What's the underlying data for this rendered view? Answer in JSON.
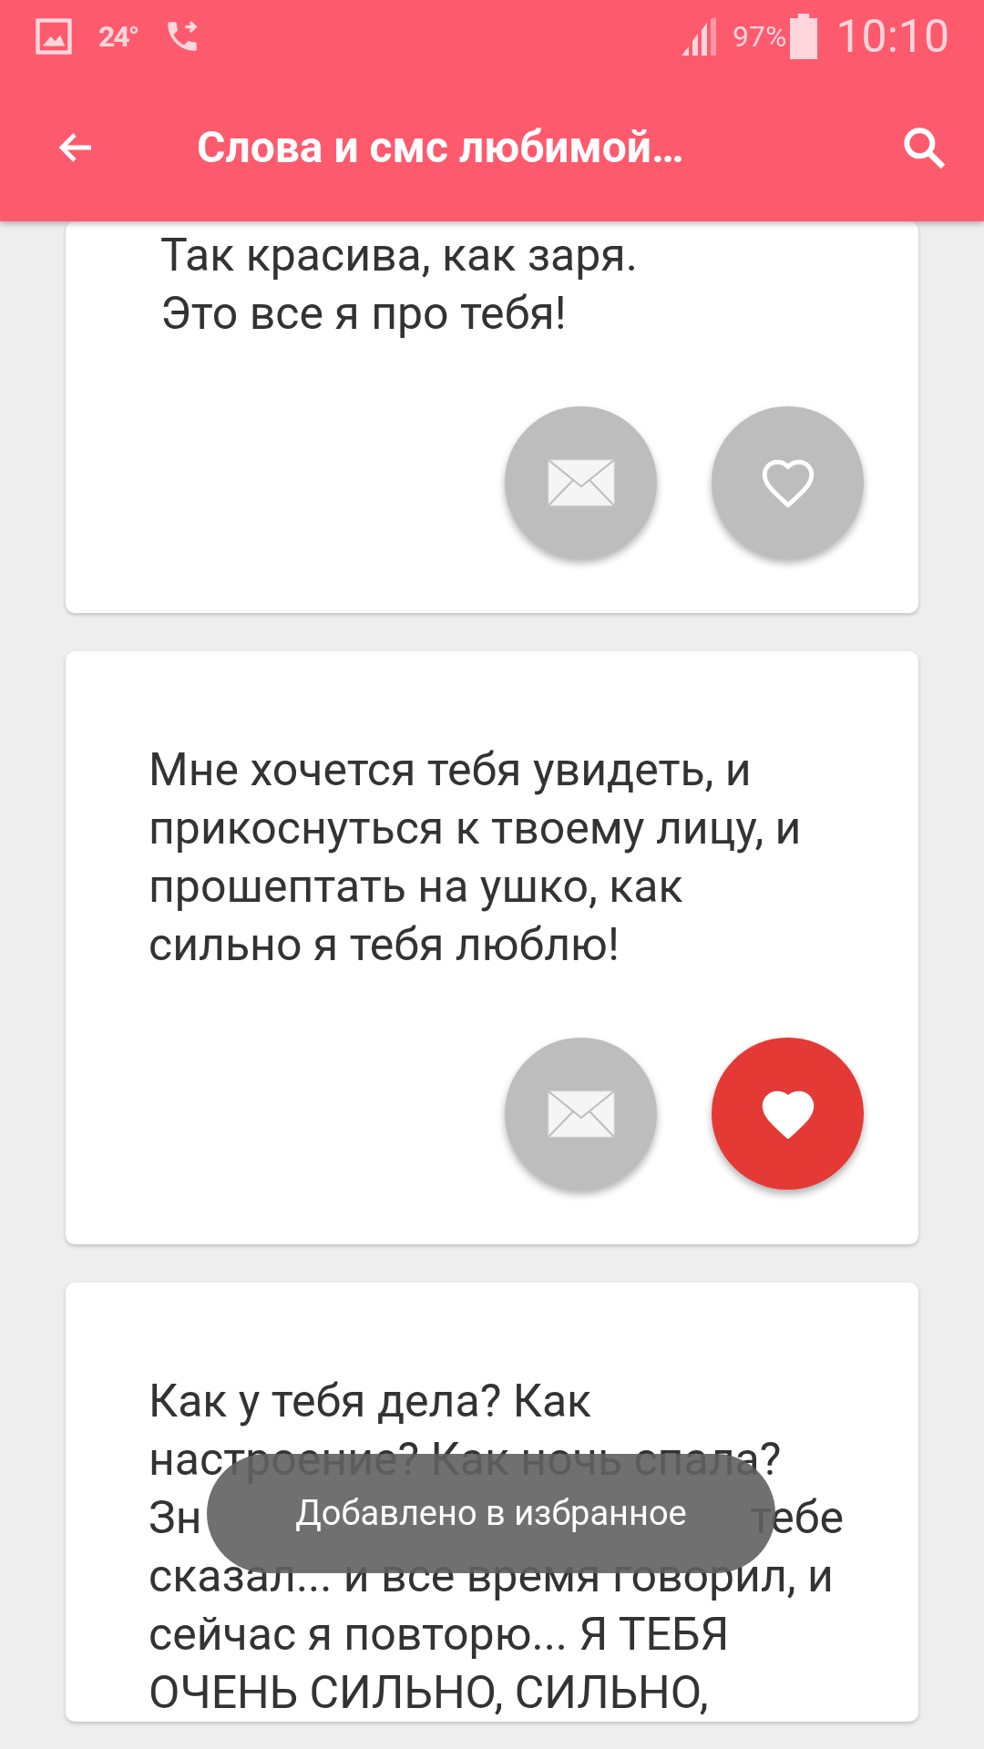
{
  "status_bar": {
    "temperature": "24°",
    "battery": "97%",
    "time": "10:10"
  },
  "app_bar": {
    "title": "Слова и смс любимой…"
  },
  "cards": [
    {
      "lines": [
        [
          "Так красива, как заря."
        ],
        [
          "Это все я про тебя!"
        ]
      ],
      "favorite": false
    },
    {
      "lines": [
        [
          "Мне хочется тебя увидеть, и"
        ],
        [
          "прикоснуться к твоему лицу, и"
        ],
        [
          "прошептать на ушко, как"
        ],
        [
          "сильно я тебя люблю!"
        ]
      ],
      "favorite": true
    },
    {
      "lines": [
        [
          "Как у тебя дела? Как"
        ],
        [
          "настроение? Как ночь спала?"
        ],
        [
          "Зн",
          "тебе"
        ],
        [
          "сказал... и все время говорил, и"
        ],
        [
          "сейчас я повторю... Я ТЕБЯ"
        ],
        [
          "ОЧЕНЬ СИЛЬНО, СИЛЬНО,"
        ]
      ]
    }
  ],
  "toast": {
    "text": "Добавлено в избранное"
  }
}
